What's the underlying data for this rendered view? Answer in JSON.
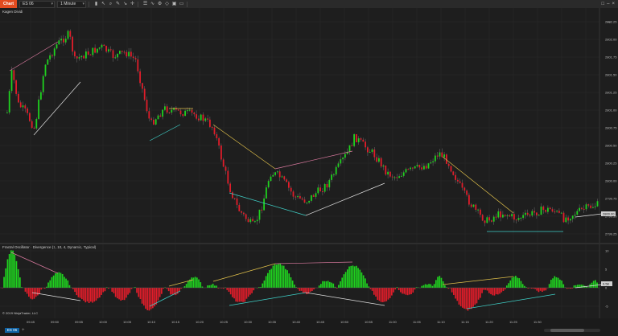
{
  "toolbar": {
    "chart_tab": "Chart",
    "instrument": "ES 06",
    "interval": "1 Minute",
    "tools": [
      "chart-trader-icon",
      "cursor-icon",
      "zoom-icon",
      "pencil-icon",
      "arrow-tool-icon",
      "crosshair-icon",
      "properties-icon",
      "indicators-icon",
      "strategies-icon",
      "drawing-icon",
      "lock-icon",
      "window-icon"
    ],
    "window_buttons": [
      "maximize-icon",
      "minimize-icon",
      "close-icon"
    ]
  },
  "price_panel": {
    "label": "Kagen Dividi",
    "y_ticks": [
      "2802.25",
      "2802.00",
      "2801.75",
      "2801.50",
      "2801.25",
      "2801.00",
      "2800.75",
      "2800.50",
      "2800.25",
      "2800.00",
      "2799.75",
      "2799.50",
      "2799.25"
    ],
    "last_price": "2800.00",
    "colors": {
      "up": "#1fd11f",
      "down": "#e01d2a",
      "pink": "#d9799e",
      "yellow": "#e0c04a",
      "cyan": "#3fd1c8",
      "white": "#e0e0e0"
    }
  },
  "osc_panel": {
    "label": "Fractal Oscillator · Divergence (1, 10, 4, Dynamic, Typical)",
    "y_ticks": [
      "10",
      "5",
      "0",
      "-5",
      "-10"
    ],
    "current_value": "0.58",
    "copyright": "© 2019 NinjaTrader, LLC"
  },
  "x_axis": {
    "ticks": [
      "09:45",
      "09:50",
      "09:55",
      "10:00",
      "10:05",
      "10:10",
      "10:15",
      "10:20",
      "10:25",
      "10:30",
      "10:35",
      "10:40",
      "10:45",
      "10:50",
      "10:55",
      "11:00",
      "11:05",
      "11:10",
      "11:15",
      "11:20",
      "11:25",
      "11:30"
    ]
  },
  "bottom": {
    "tab_label": "ES 06",
    "add_tab": "+"
  }
}
